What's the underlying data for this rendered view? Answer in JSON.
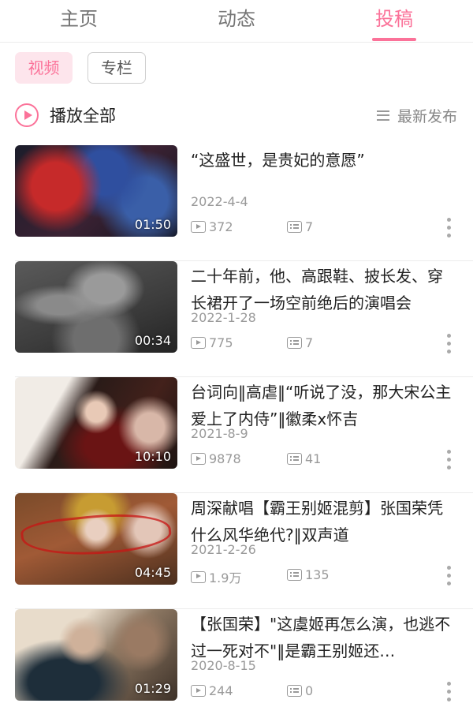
{
  "tabs": [
    {
      "label": "主页",
      "active": false
    },
    {
      "label": "动态",
      "active": false
    },
    {
      "label": "投稿",
      "active": true
    }
  ],
  "filters": [
    {
      "label": "视频",
      "selected": true
    },
    {
      "label": "专栏",
      "selected": false
    }
  ],
  "play_all": {
    "label": "播放全部",
    "icon": "play-circle-icon"
  },
  "sort": {
    "label": "最新发布",
    "icon": "menu-lines-icon"
  },
  "accent_color": "#fb7299",
  "videos": [
    {
      "title": "“这盛世，是贵妃的意愿”",
      "date": "2022-4-4",
      "plays": "372",
      "danmaku": "7",
      "duration": "01:50"
    },
    {
      "title": "二十年前，他、高跟鞋、披长发、穿长裙开了一场空前绝后的演唱会",
      "date": "2022-1-28",
      "plays": "775",
      "danmaku": "7",
      "duration": "00:34"
    },
    {
      "title": "台词向‖高虐‖“听说了没，那大宋公主爱上了内侍”‖徽柔x怀吉",
      "date": "2021-8-9",
      "plays": "9878",
      "danmaku": "41",
      "duration": "10:10"
    },
    {
      "title": "周深献唱【霸王别姬混剪】张国荣凭什么风华绝代?‖双声道",
      "date": "2021-2-26",
      "plays": "1.9万",
      "danmaku": "135",
      "duration": "04:45"
    },
    {
      "title": "【张国荣】\"这虞姬再怎么演，也逃不过一死对不\"‖是霸王别姬还…",
      "date": "2020-8-15",
      "plays": "244",
      "danmaku": "0",
      "duration": "01:29"
    }
  ]
}
